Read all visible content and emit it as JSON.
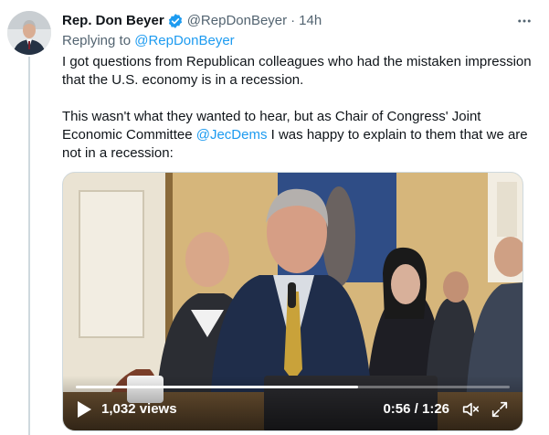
{
  "tweet": {
    "author_name": "Rep. Don Beyer",
    "handle": "@RepDonBeyer",
    "separator": "·",
    "time": "14h",
    "replying_prefix": "Replying to ",
    "replying_handle": "@RepDonBeyer",
    "paragraph1": "I got questions from Republican colleagues who had the mistaken impression that the U.S. economy is in a recession.",
    "paragraph2_before": "This wasn't what they wanted to hear, but as Chair of Congress' Joint Economic Committee ",
    "paragraph2_mention": "@JecDems",
    "paragraph2_after": " I was happy to explain to them that we are not in a recession:"
  },
  "video": {
    "views": "1,032 views",
    "timecode": "0:56 / 1:26",
    "progress_fraction": 0.65
  },
  "colors": {
    "accent": "#1d9bf0",
    "secondary_text": "#536471",
    "primary_text": "#0f1419"
  },
  "icons": {
    "verified": "verified-badge-icon",
    "more": "more-dots-icon",
    "play": "play-icon",
    "volume": "volume-icon",
    "fullscreen": "fullscreen-icon"
  }
}
